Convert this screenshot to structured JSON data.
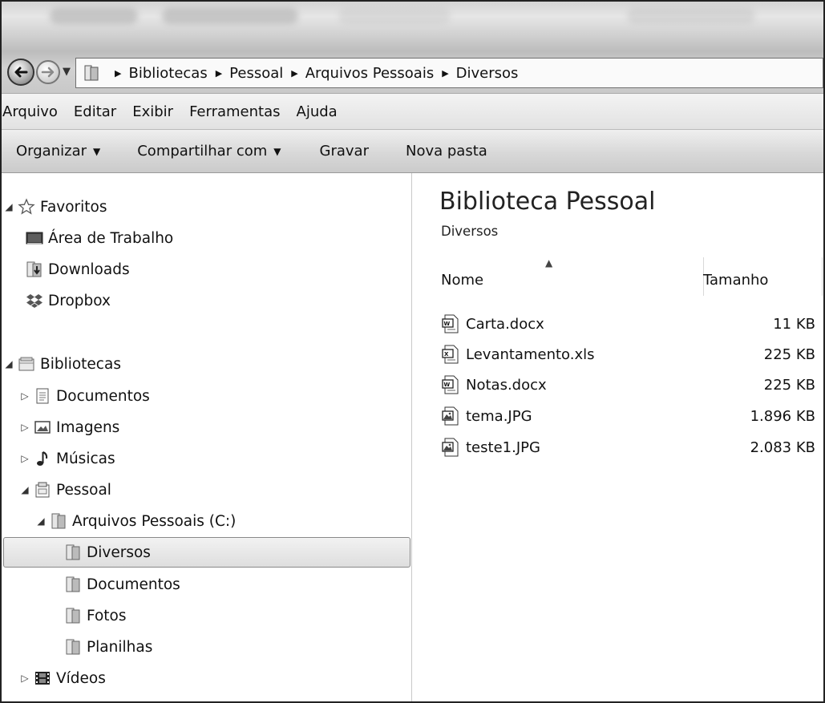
{
  "address_bar": {
    "breadcrumb": [
      "Bibliotecas",
      "Pessoal",
      "Arquivos Pessoais",
      "Diversos"
    ]
  },
  "menu": [
    "Arquivo",
    "Editar",
    "Exibir",
    "Ferramentas",
    "Ajuda"
  ],
  "toolbar": {
    "organize": "Organizar",
    "share": "Compartilhar com",
    "burn": "Gravar",
    "new_folder": "Nova pasta"
  },
  "nav": {
    "favorites": "Favoritos",
    "desktop": "Área de Trabalho",
    "downloads": "Downloads",
    "dropbox": "Dropbox",
    "libraries": "Bibliotecas",
    "documents": "Documentos",
    "images": "Imagens",
    "music": "Músicas",
    "personal": "Pessoal",
    "personal_files": "Arquivos Pessoais (C:)",
    "misc": "Diversos",
    "sub_documents": "Documentos",
    "photos": "Fotos",
    "spreadsheets": "Planilhas",
    "videos": "Vídeos"
  },
  "content": {
    "title": "Biblioteca Pessoal",
    "subtitle": "Diversos",
    "columns": {
      "name": "Nome",
      "size": "Tamanho"
    },
    "files": [
      {
        "name": "Carta.docx",
        "size": "11 KB",
        "icon": "word-doc-icon"
      },
      {
        "name": "Levantamento.xls",
        "size": "225 KB",
        "icon": "excel-doc-icon"
      },
      {
        "name": "Notas.docx",
        "size": "225 KB",
        "icon": "word-doc-icon"
      },
      {
        "name": "tema.JPG",
        "size": "1.896 KB",
        "icon": "image-file-icon"
      },
      {
        "name": "teste1.JPG",
        "size": "2.083 KB",
        "icon": "image-file-icon"
      }
    ]
  }
}
